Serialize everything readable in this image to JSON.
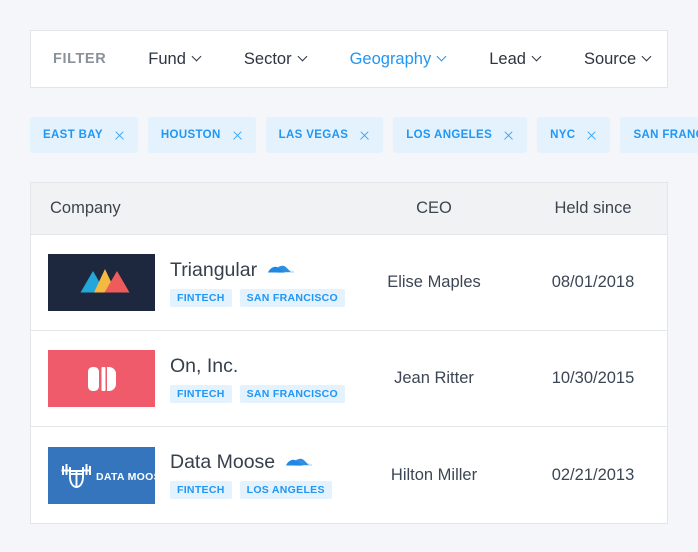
{
  "filter_bar": {
    "label": "FILTER",
    "items": [
      {
        "label": "Fund",
        "active": false
      },
      {
        "label": "Sector",
        "active": false
      },
      {
        "label": "Geography",
        "active": true
      },
      {
        "label": "Lead",
        "active": false
      },
      {
        "label": "Source",
        "active": false
      }
    ]
  },
  "chips": [
    {
      "label": "EAST BAY"
    },
    {
      "label": "HOUSTON"
    },
    {
      "label": "LAS VEGAS"
    },
    {
      "label": "LOS ANGELES"
    },
    {
      "label": "NYC"
    },
    {
      "label": "SAN FRANCISCO"
    }
  ],
  "table": {
    "columns": [
      "Company",
      "CEO",
      "Held since"
    ],
    "rows": [
      {
        "company": "Triangular",
        "has_wave_icon": true,
        "badges": [
          "FINTECH",
          "SAN FRANCISCO"
        ],
        "ceo": "Elise Maples",
        "held_since": "08/01/2018",
        "logo": {
          "kind": "triangles",
          "bg": "#1d283f",
          "colors": [
            "#22a7d8",
            "#f5b841",
            "#ef5b5b"
          ]
        }
      },
      {
        "company": "On, Inc.",
        "has_wave_icon": false,
        "badges": [
          "FINTECH",
          "SAN FRANCISCO"
        ],
        "ceo": "Jean Ritter",
        "held_since": "10/30/2015",
        "logo": {
          "kind": "on-mark",
          "bg": "#ef5b6b",
          "colors": [
            "#ffffff"
          ]
        }
      },
      {
        "company": "Data Moose",
        "has_wave_icon": true,
        "badges": [
          "FINTECH",
          "LOS ANGELES"
        ],
        "ceo": "Hilton Miller",
        "held_since": "02/21/2013",
        "logo": {
          "kind": "moose",
          "bg": "#3575bd",
          "colors": [
            "#ffffff"
          ],
          "wordmark": "DATA MOOSE"
        }
      }
    ]
  },
  "theme": {
    "page_bg": "#f4f6f9",
    "accent": "#2196f3",
    "badge_bg": "#e3f2fd",
    "header_bg": "#f1f2f3",
    "border": "#e2e5e9",
    "text": "#3c4654"
  }
}
